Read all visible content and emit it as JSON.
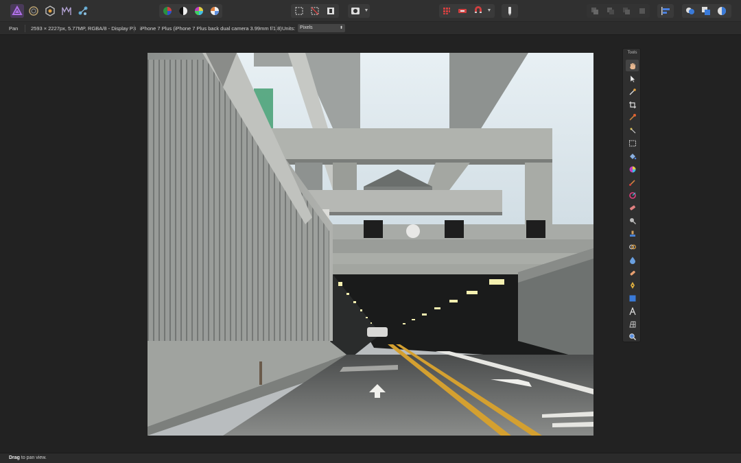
{
  "toolbar": {
    "personas": [
      "photo-persona-icon",
      "liquify-persona-icon",
      "develop-persona-icon",
      "tone-mapping-persona-icon",
      "export-persona-icon"
    ],
    "accent_color": "#8a3cc8"
  },
  "context": {
    "tool_name": "Pan",
    "image_info": "2593 × 2227px, 5.77MP, RGBA/8 - Display P3",
    "camera_info": "iPhone 7 Plus (iPhone 7 Plus back dual camera 3.99mm f/1.8)",
    "units_label": "Units:",
    "units_value": "Pixels"
  },
  "tools_panel": {
    "title": "Tools"
  },
  "status": {
    "bold": "Drag",
    "rest": " to pan view."
  }
}
